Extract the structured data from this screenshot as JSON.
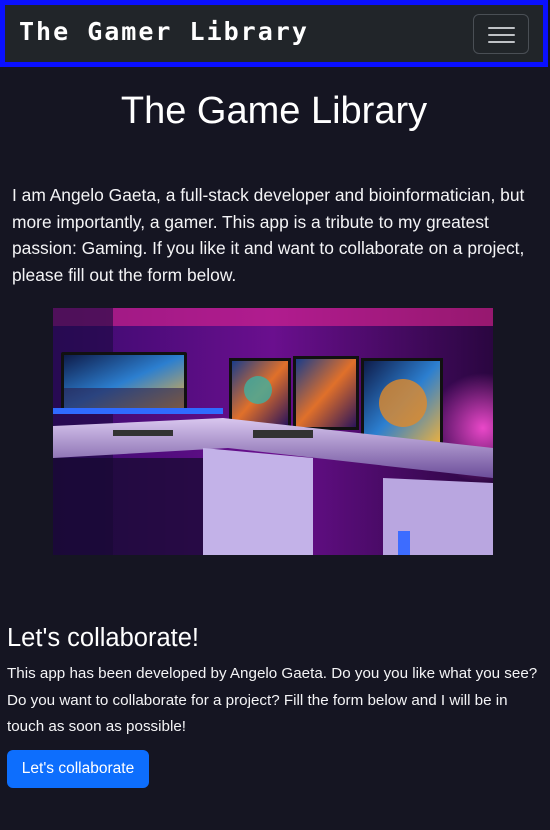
{
  "navbar": {
    "brand": "The Gamer Library",
    "toggle_icon": "hamburger-menu-icon"
  },
  "header": {
    "title": "The Game Library"
  },
  "intro": {
    "text": "I am Angelo Gaeta, a full-stack developer and bioinformatician, but more importantly, a gamer. This app is a tribute to my greatest passion: Gaming. If you like it and want to collaborate on a project, please fill out the form below."
  },
  "hero_image": {
    "subject": "gaming-setup-photo"
  },
  "collaborate": {
    "title": "Let's collaborate!",
    "text": "This app has been developed by Angelo Gaeta. Do you you like what you see? Do you want to collaborate for a project? Fill the form below and I will be in touch as soon as possible!",
    "button_label": "Let's collaborate"
  },
  "colors": {
    "background": "#151522",
    "navbar_border": "#0a10ff",
    "navbar_bg": "#212529",
    "button_primary": "#0d6efd",
    "text": "#ffffff"
  }
}
